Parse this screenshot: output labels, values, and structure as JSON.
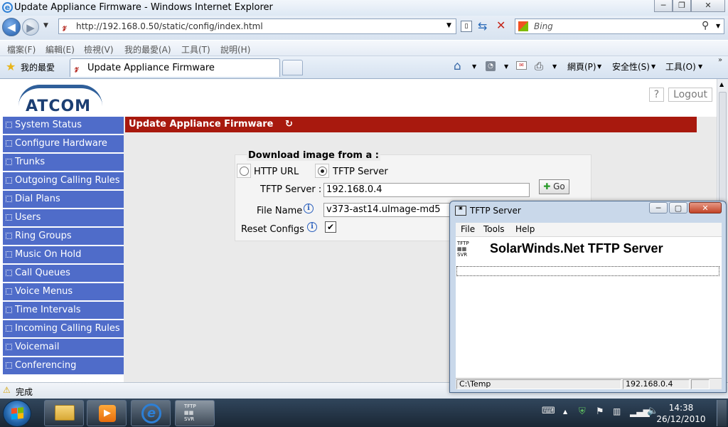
{
  "window": {
    "title": "Update Appliance Firmware - Windows Internet Explorer",
    "minimize": "─",
    "restore": "❐",
    "close": "✕"
  },
  "address": {
    "url": "http://192.168.0.50/static/config/index.html",
    "search_placeholder": "Bing"
  },
  "menu": [
    "檔案(F)",
    "編輯(E)",
    "檢視(V)",
    "我的最愛(A)",
    "工具(T)",
    "說明(H)"
  ],
  "favorites": {
    "label": "我的最愛",
    "tab_title": "Update Appliance Firmware",
    "page_menu": "網頁(P)",
    "safety_menu": "安全性(S)",
    "tools_menu": "工具(O)"
  },
  "page": {
    "logo": "ATCOM",
    "help": "?",
    "logout": "Logout",
    "header": "Update Appliance Firmware",
    "sidebar": [
      "System Status",
      "Configure Hardware",
      "Trunks",
      "Outgoing Calling Rules",
      "Dial Plans",
      "Users",
      "Ring Groups",
      "Music On Hold",
      "Call Queues",
      "Voice Menus",
      "Time Intervals",
      "Incoming Calling Rules",
      "Voicemail",
      "Conferencing"
    ],
    "form": {
      "legend": "Download image from a :",
      "http_label": "HTTP URL",
      "tftp_label": "TFTP Server",
      "tftp_server_label": "TFTP Server :",
      "tftp_server_value": "192.168.0.4",
      "file_name_label": "File Name",
      "file_name_value": "v373-ast14.uImage-md5",
      "reset_label": "Reset Configs",
      "reset_checked": true,
      "go": "Go"
    }
  },
  "status": {
    "text": "完成"
  },
  "taskbar": {
    "time": "14:38",
    "date": "26/12/2010"
  },
  "tftp": {
    "title": "TFTP Server",
    "menu": [
      "File",
      "Tools",
      "Help"
    ],
    "banner": "SolarWinds.Net TFTP Server",
    "icon_text_top": "TFTP",
    "icon_text_bottom": "SVR",
    "root_dir": "C:\\Temp",
    "ip": "192.168.0.4"
  },
  "colors": {
    "sidebar": "#4f6cc9",
    "header": "#a8190e",
    "brand": "#1c3f73"
  }
}
